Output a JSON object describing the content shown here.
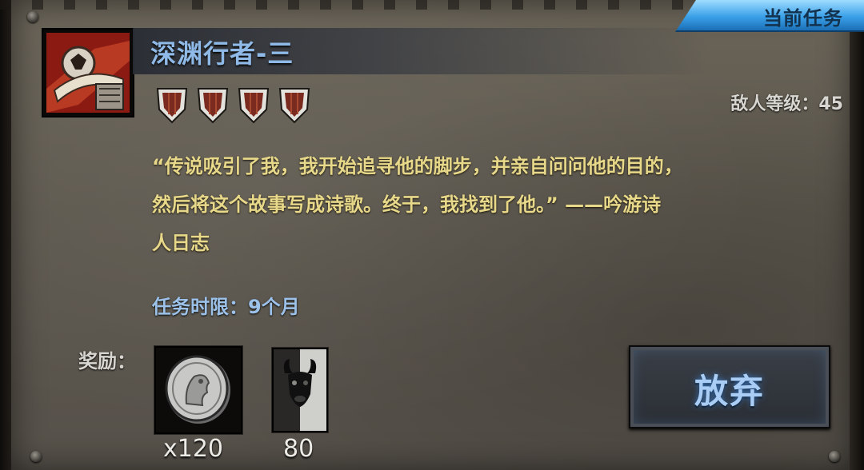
{
  "header": {
    "tab_label": "当前任务"
  },
  "quest": {
    "title": "深渊行者-三",
    "difficulty_shields": 4,
    "enemy_level_label": "敌人等级：45",
    "description_lines": [
      "“传说吸引了我，我开始追寻他的脚步，并亲自问问他的目的，",
      "然后将这个故事写成诗歌。终于，我找到了他。” ——吟游诗",
      "人日志"
    ],
    "time_limit_label": "任务时限：9个月"
  },
  "rewards": {
    "label": "奖励：",
    "items": [
      {
        "icon": "silver-coin-icon",
        "count": "x120"
      },
      {
        "icon": "minotaur-banner-icon",
        "count": "80"
      }
    ]
  },
  "actions": {
    "abandon_label": "放弃"
  },
  "colors": {
    "title": "#8fb9e6",
    "description": "#e8d98a",
    "time_limit": "#9cc2ea",
    "tab": "#3aa0e8"
  }
}
